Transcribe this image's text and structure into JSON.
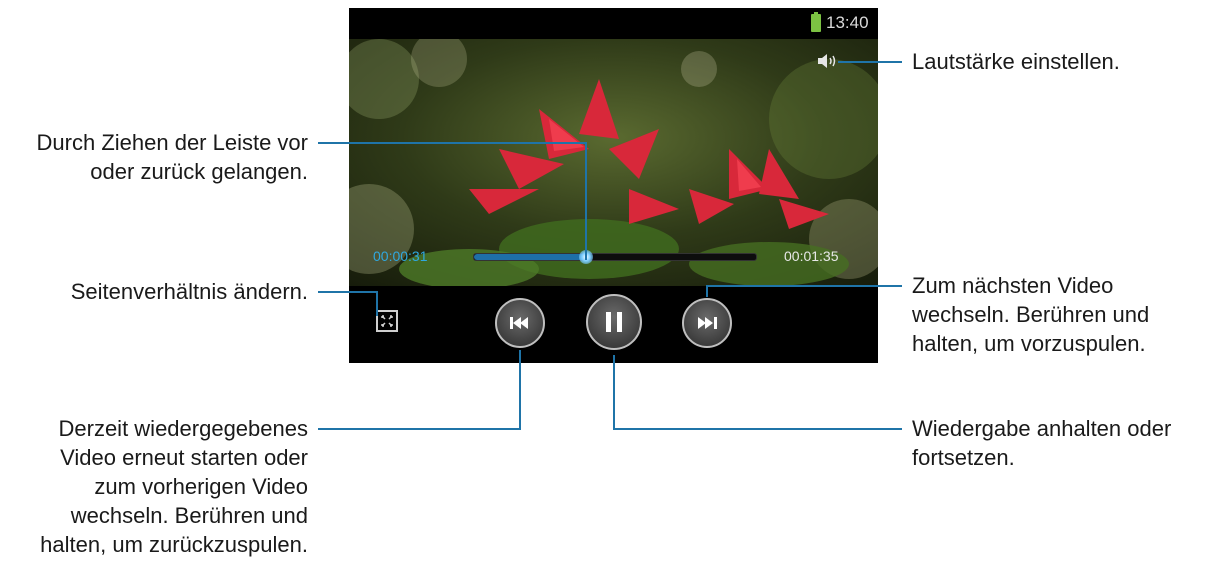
{
  "status_bar": {
    "time": "13:40",
    "battery_color": "#7cc243"
  },
  "player": {
    "elapsed": "00:00:31",
    "duration": "00:01:35",
    "progress_fraction": 0.4,
    "accent_color": "#2fa8e0",
    "icons": {
      "volume": "speaker-icon",
      "aspect": "aspect-ratio-icon",
      "prev": "previous-track-icon",
      "pause": "pause-icon",
      "next": "next-track-icon"
    }
  },
  "callouts": {
    "volume": "Lautstärke einstellen.",
    "seek": [
      "Durch Ziehen der Leiste vor",
      "oder zurück gelangen."
    ],
    "aspect": "Seitenverhältnis ändern.",
    "next": [
      "Zum nächsten Video",
      "wechseln. Berühren und",
      "halten, um vorzuspulen."
    ],
    "prev": [
      "Derzeit wiedergegebenes",
      "Video erneut starten oder",
      "zum vorherigen Video",
      "wechseln. Berühren und",
      "halten, um zurückzuspulen."
    ],
    "pause": [
      "Wiedergabe anhalten oder",
      "fortsetzen."
    ]
  }
}
